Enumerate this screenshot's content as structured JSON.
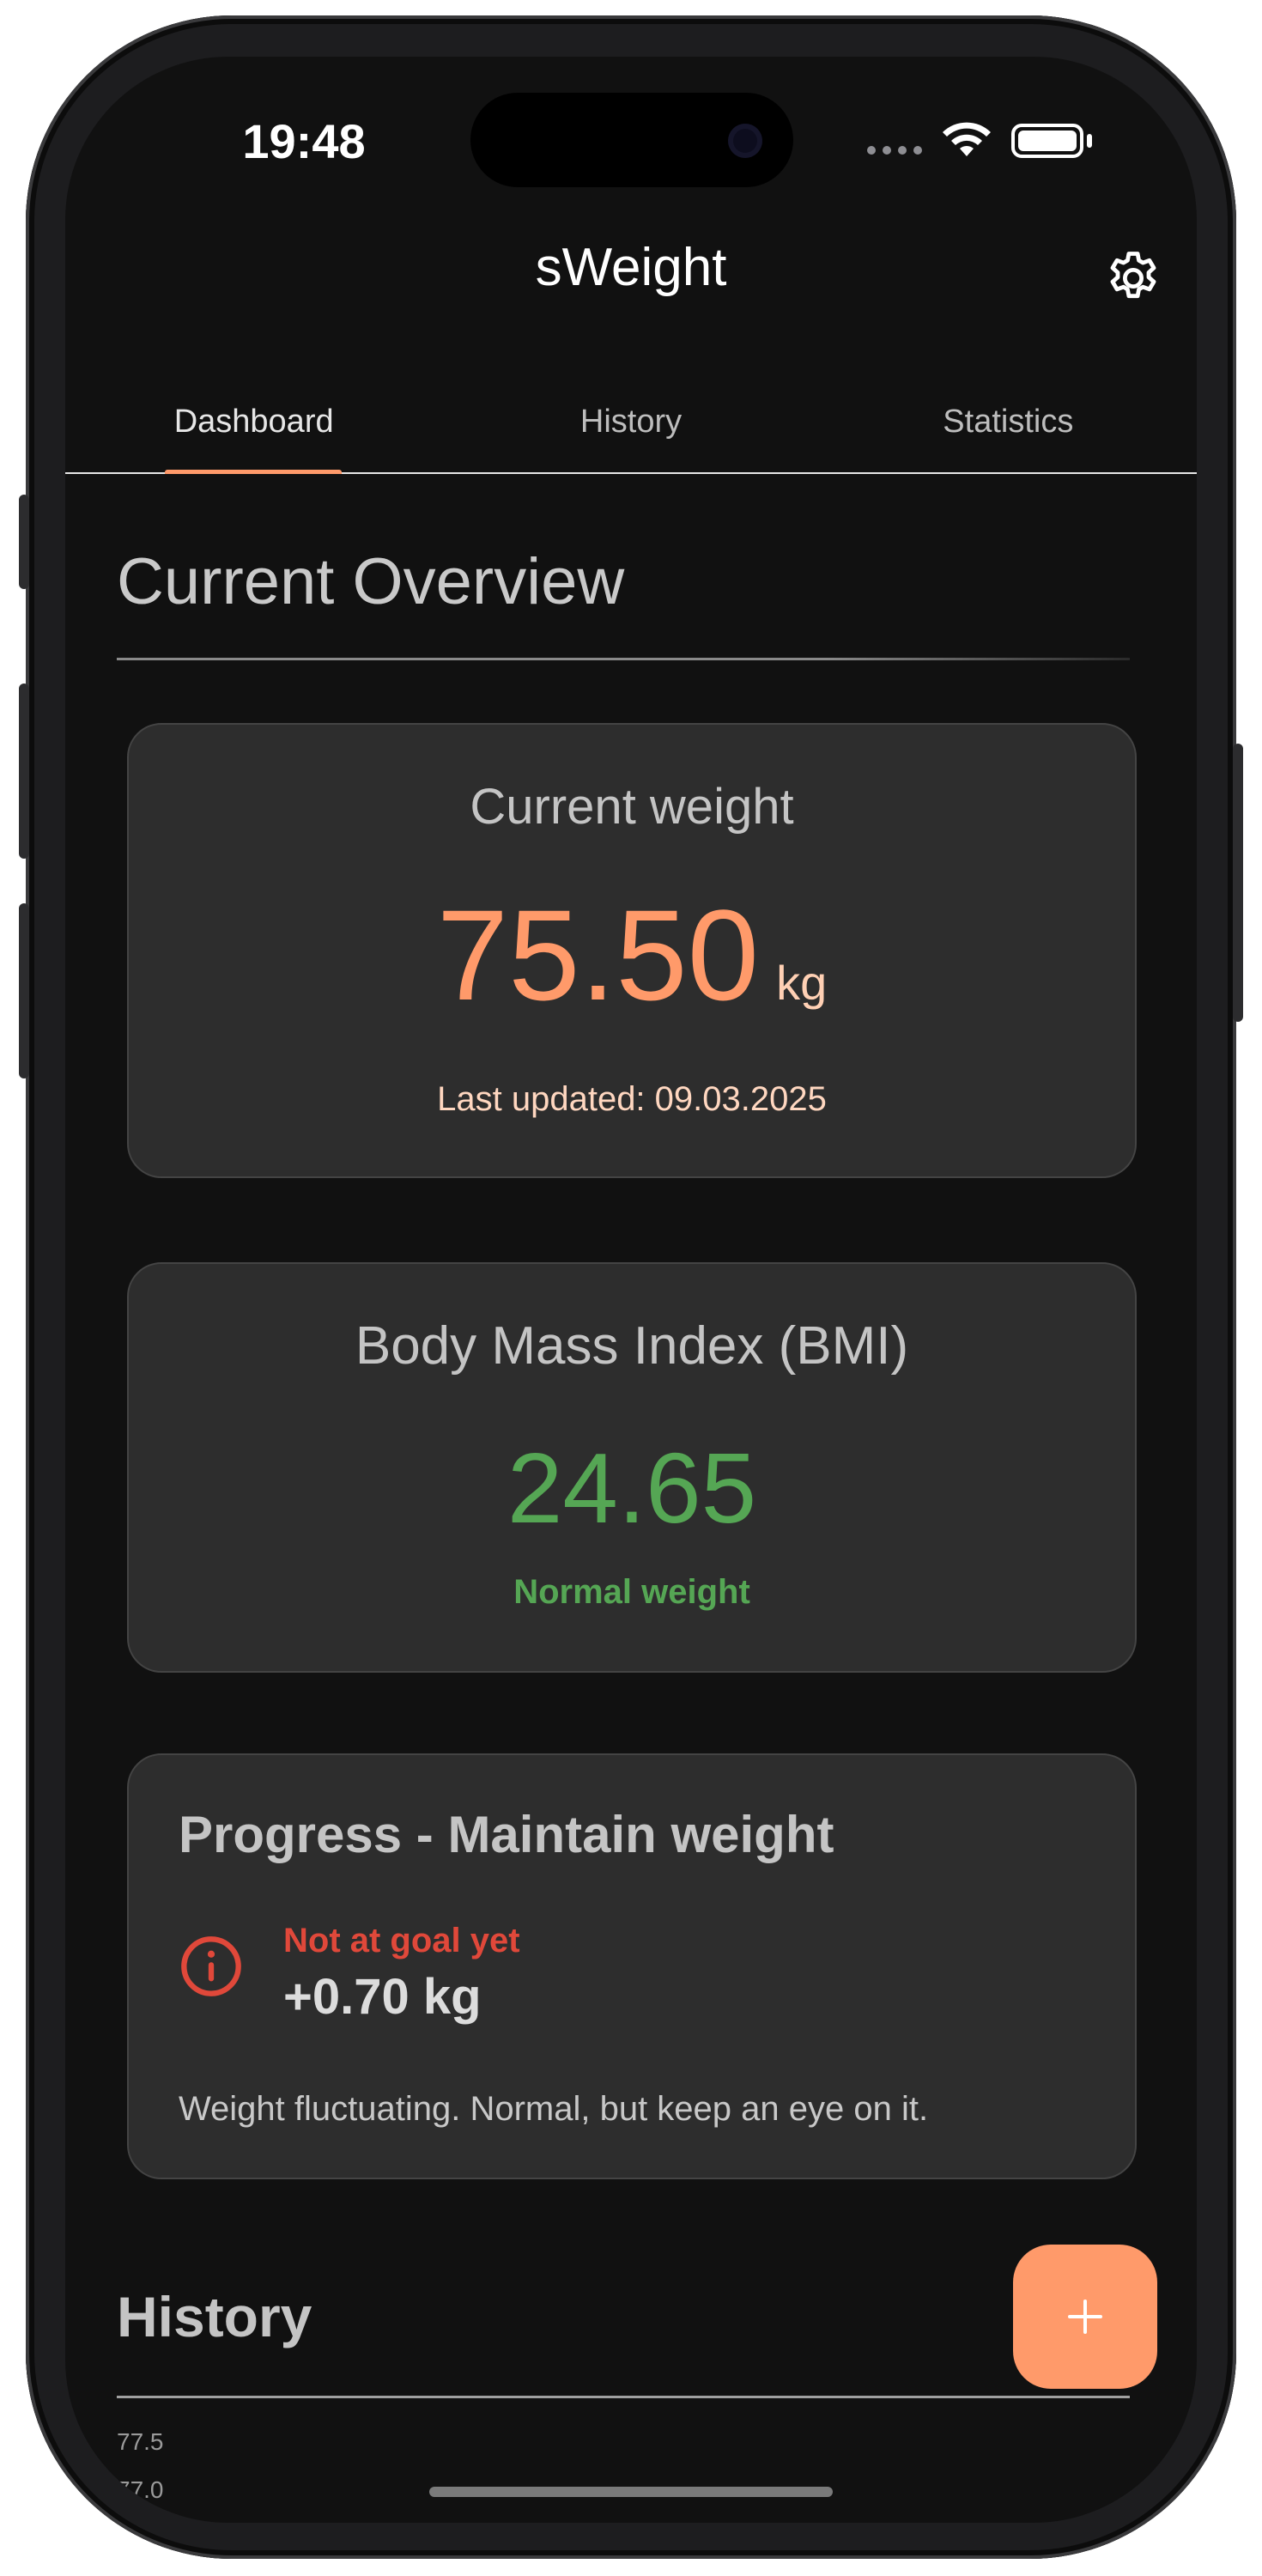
{
  "status_bar": {
    "time": "19:48"
  },
  "app_bar": {
    "title": "sWeight",
    "settings_icon": "gear-icon"
  },
  "tabs": [
    {
      "label": "Dashboard",
      "active": true
    },
    {
      "label": "History",
      "active": false
    },
    {
      "label": "Statistics",
      "active": false
    }
  ],
  "overview": {
    "title": "Current Overview",
    "current_weight": {
      "title": "Current weight",
      "value": "75.50",
      "unit": "kg",
      "last_updated": "Last updated: 09.03.2025"
    },
    "bmi": {
      "title": "Body Mass Index (BMI)",
      "value": "24.65",
      "category": "Normal weight"
    },
    "progress": {
      "title": "Progress - Maintain weight",
      "icon": "info-icon",
      "status": "Not at goal yet",
      "difference": "+0.70 kg",
      "note": "Weight fluctuating. Normal, but keep an eye on it."
    }
  },
  "history": {
    "title": "History",
    "ticks": [
      "77.5",
      "77.0"
    ]
  },
  "fab": {
    "icon": "plus-icon"
  },
  "colors": {
    "accent": "#ff9a6a",
    "bmi_normal": "#55a654",
    "warning": "#e0483a",
    "card_bg": "#2d2d2d",
    "screen_bg": "#111111"
  }
}
